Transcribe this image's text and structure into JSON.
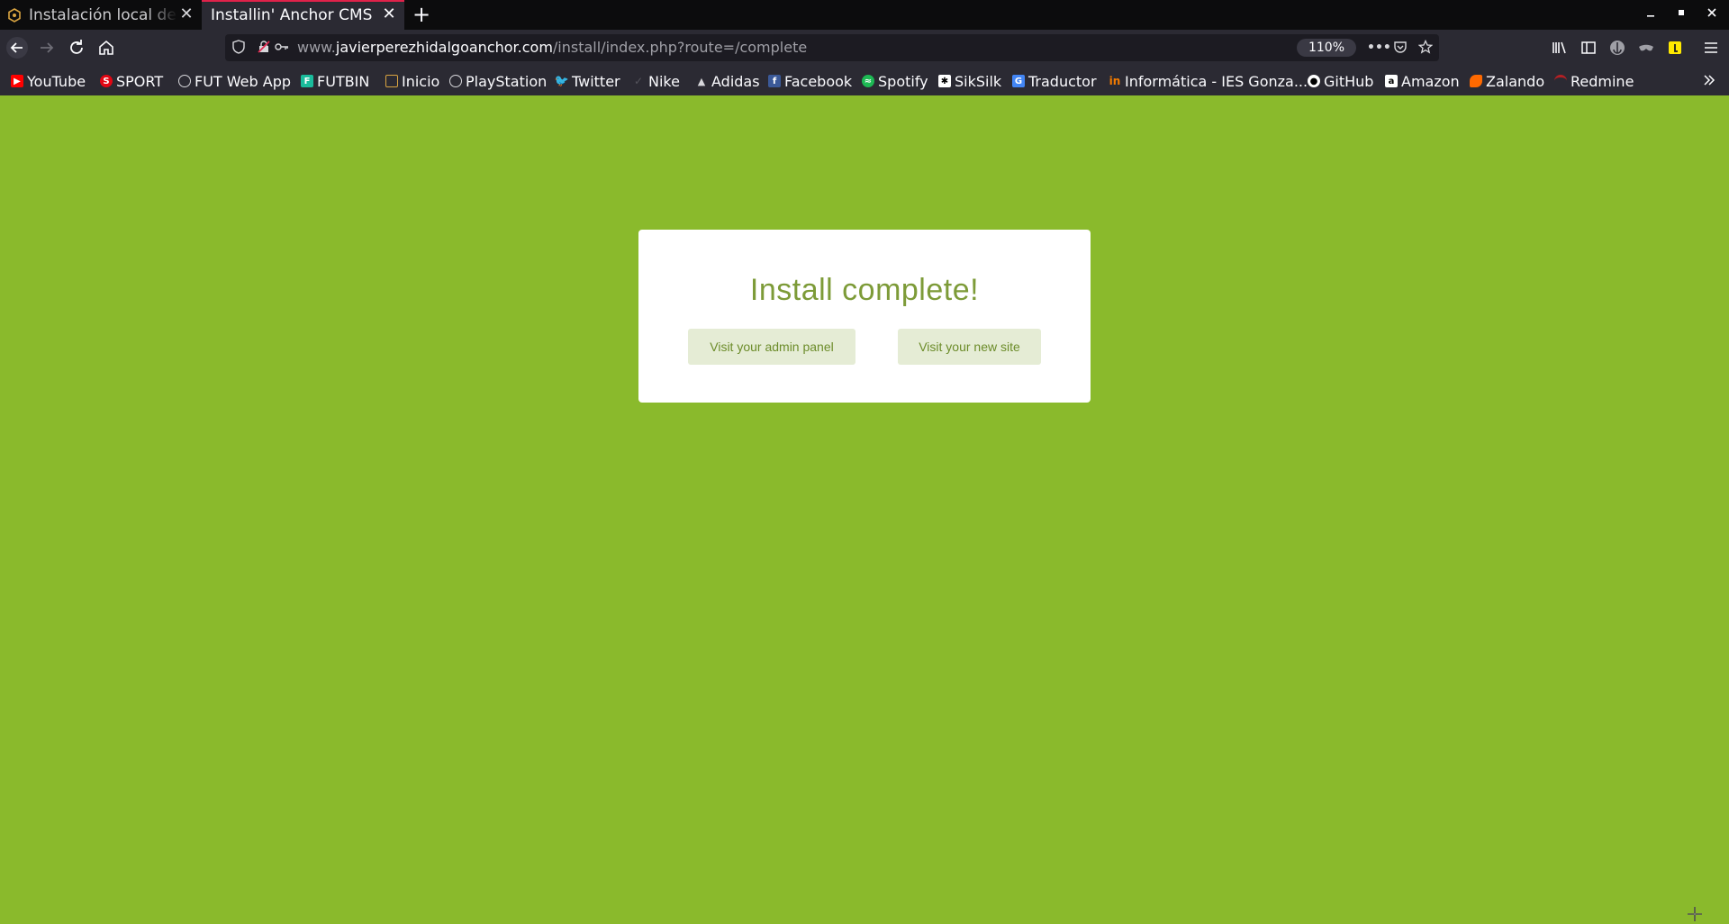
{
  "browser": {
    "tabs": [
      {
        "title": "Instalación local de un",
        "active": false
      },
      {
        "title": "Installin' Anchor CMS",
        "active": true
      }
    ],
    "url": {
      "prefix": "www.",
      "domain": "javierperezhidalgoanchor.com",
      "path": "/install/index.php?route=/complete"
    },
    "zoom": "110%",
    "bookmarks": [
      {
        "label": "YouTube",
        "icon": "youtube-icon",
        "color": "#ff0000"
      },
      {
        "label": "SPORT",
        "icon": "sport-icon",
        "color": "#e30613"
      },
      {
        "label": "FUT Web App",
        "icon": "globe-icon",
        "color": "#9f9fa6"
      },
      {
        "label": "FUTBIN",
        "icon": "futbin-icon",
        "color": "#1abc9c"
      },
      {
        "label": "Inicio",
        "icon": "inicio-icon",
        "color": "#d9a441"
      },
      {
        "label": "PlayStation",
        "icon": "globe-icon",
        "color": "#9f9fa6"
      },
      {
        "label": "Twitter",
        "icon": "twitter-icon",
        "color": "#1da1f2"
      },
      {
        "label": "Nike",
        "icon": "nike-icon",
        "color": "#3a3a3a"
      },
      {
        "label": "Adidas",
        "icon": "adidas-icon",
        "color": "#000000"
      },
      {
        "label": "Facebook",
        "icon": "facebook-icon",
        "color": "#3b5998"
      },
      {
        "label": "Spotify",
        "icon": "spotify-icon",
        "color": "#1db954"
      },
      {
        "label": "SikSilk",
        "icon": "siksilk-icon",
        "color": "#ffffff"
      },
      {
        "label": "Traductor",
        "icon": "translate-icon",
        "color": "#4285f4"
      },
      {
        "label": "Informática - IES Gonza...",
        "icon": "ies-icon",
        "color": "#f57c00"
      },
      {
        "label": "GitHub",
        "icon": "github-icon",
        "color": "#ffffff"
      },
      {
        "label": "Amazon",
        "icon": "amazon-icon",
        "color": "#ffffff"
      },
      {
        "label": "Zalando",
        "icon": "zalando-icon",
        "color": "#ff6900"
      },
      {
        "label": "Redmine",
        "icon": "redmine-icon",
        "color": "#b32024"
      }
    ]
  },
  "page": {
    "title": "Install complete!",
    "admin_button": "Visit your admin panel",
    "site_button": "Visit your new site",
    "background_color": "#8aba2c"
  }
}
